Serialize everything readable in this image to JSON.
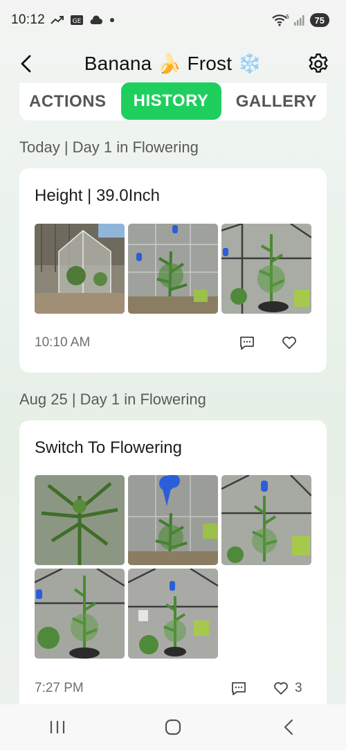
{
  "status_bar": {
    "time": "10:12",
    "battery": "75",
    "icons": [
      "trend-icon",
      "ge-icon",
      "cloud-icon",
      "dot-icon",
      "wifi-icon",
      "signal-icon"
    ]
  },
  "header": {
    "title": "Banana 🍌 Frost ❄️",
    "back_icon": "chevron-left-icon",
    "settings_icon": "gear-icon"
  },
  "tabs": [
    {
      "label": "ACTIONS",
      "active": false
    },
    {
      "label": "HISTORY",
      "active": true
    },
    {
      "label": "GALLERY",
      "active": false
    }
  ],
  "colors": {
    "accent": "#1fcf5e",
    "card": "#ffffff",
    "text_muted": "#6f6f6f"
  },
  "history": [
    {
      "section": "Today | Day 1 in Flowering",
      "card": {
        "title": "Height | 39.0Inch",
        "photo_count": 3,
        "time": "10:10 AM",
        "likes": ""
      }
    },
    {
      "section": "Aug 25 | Day 1 in Flowering",
      "card": {
        "title": "Switch To Flowering",
        "photo_count": 5,
        "time": "7:27 PM",
        "likes": "3"
      }
    }
  ]
}
